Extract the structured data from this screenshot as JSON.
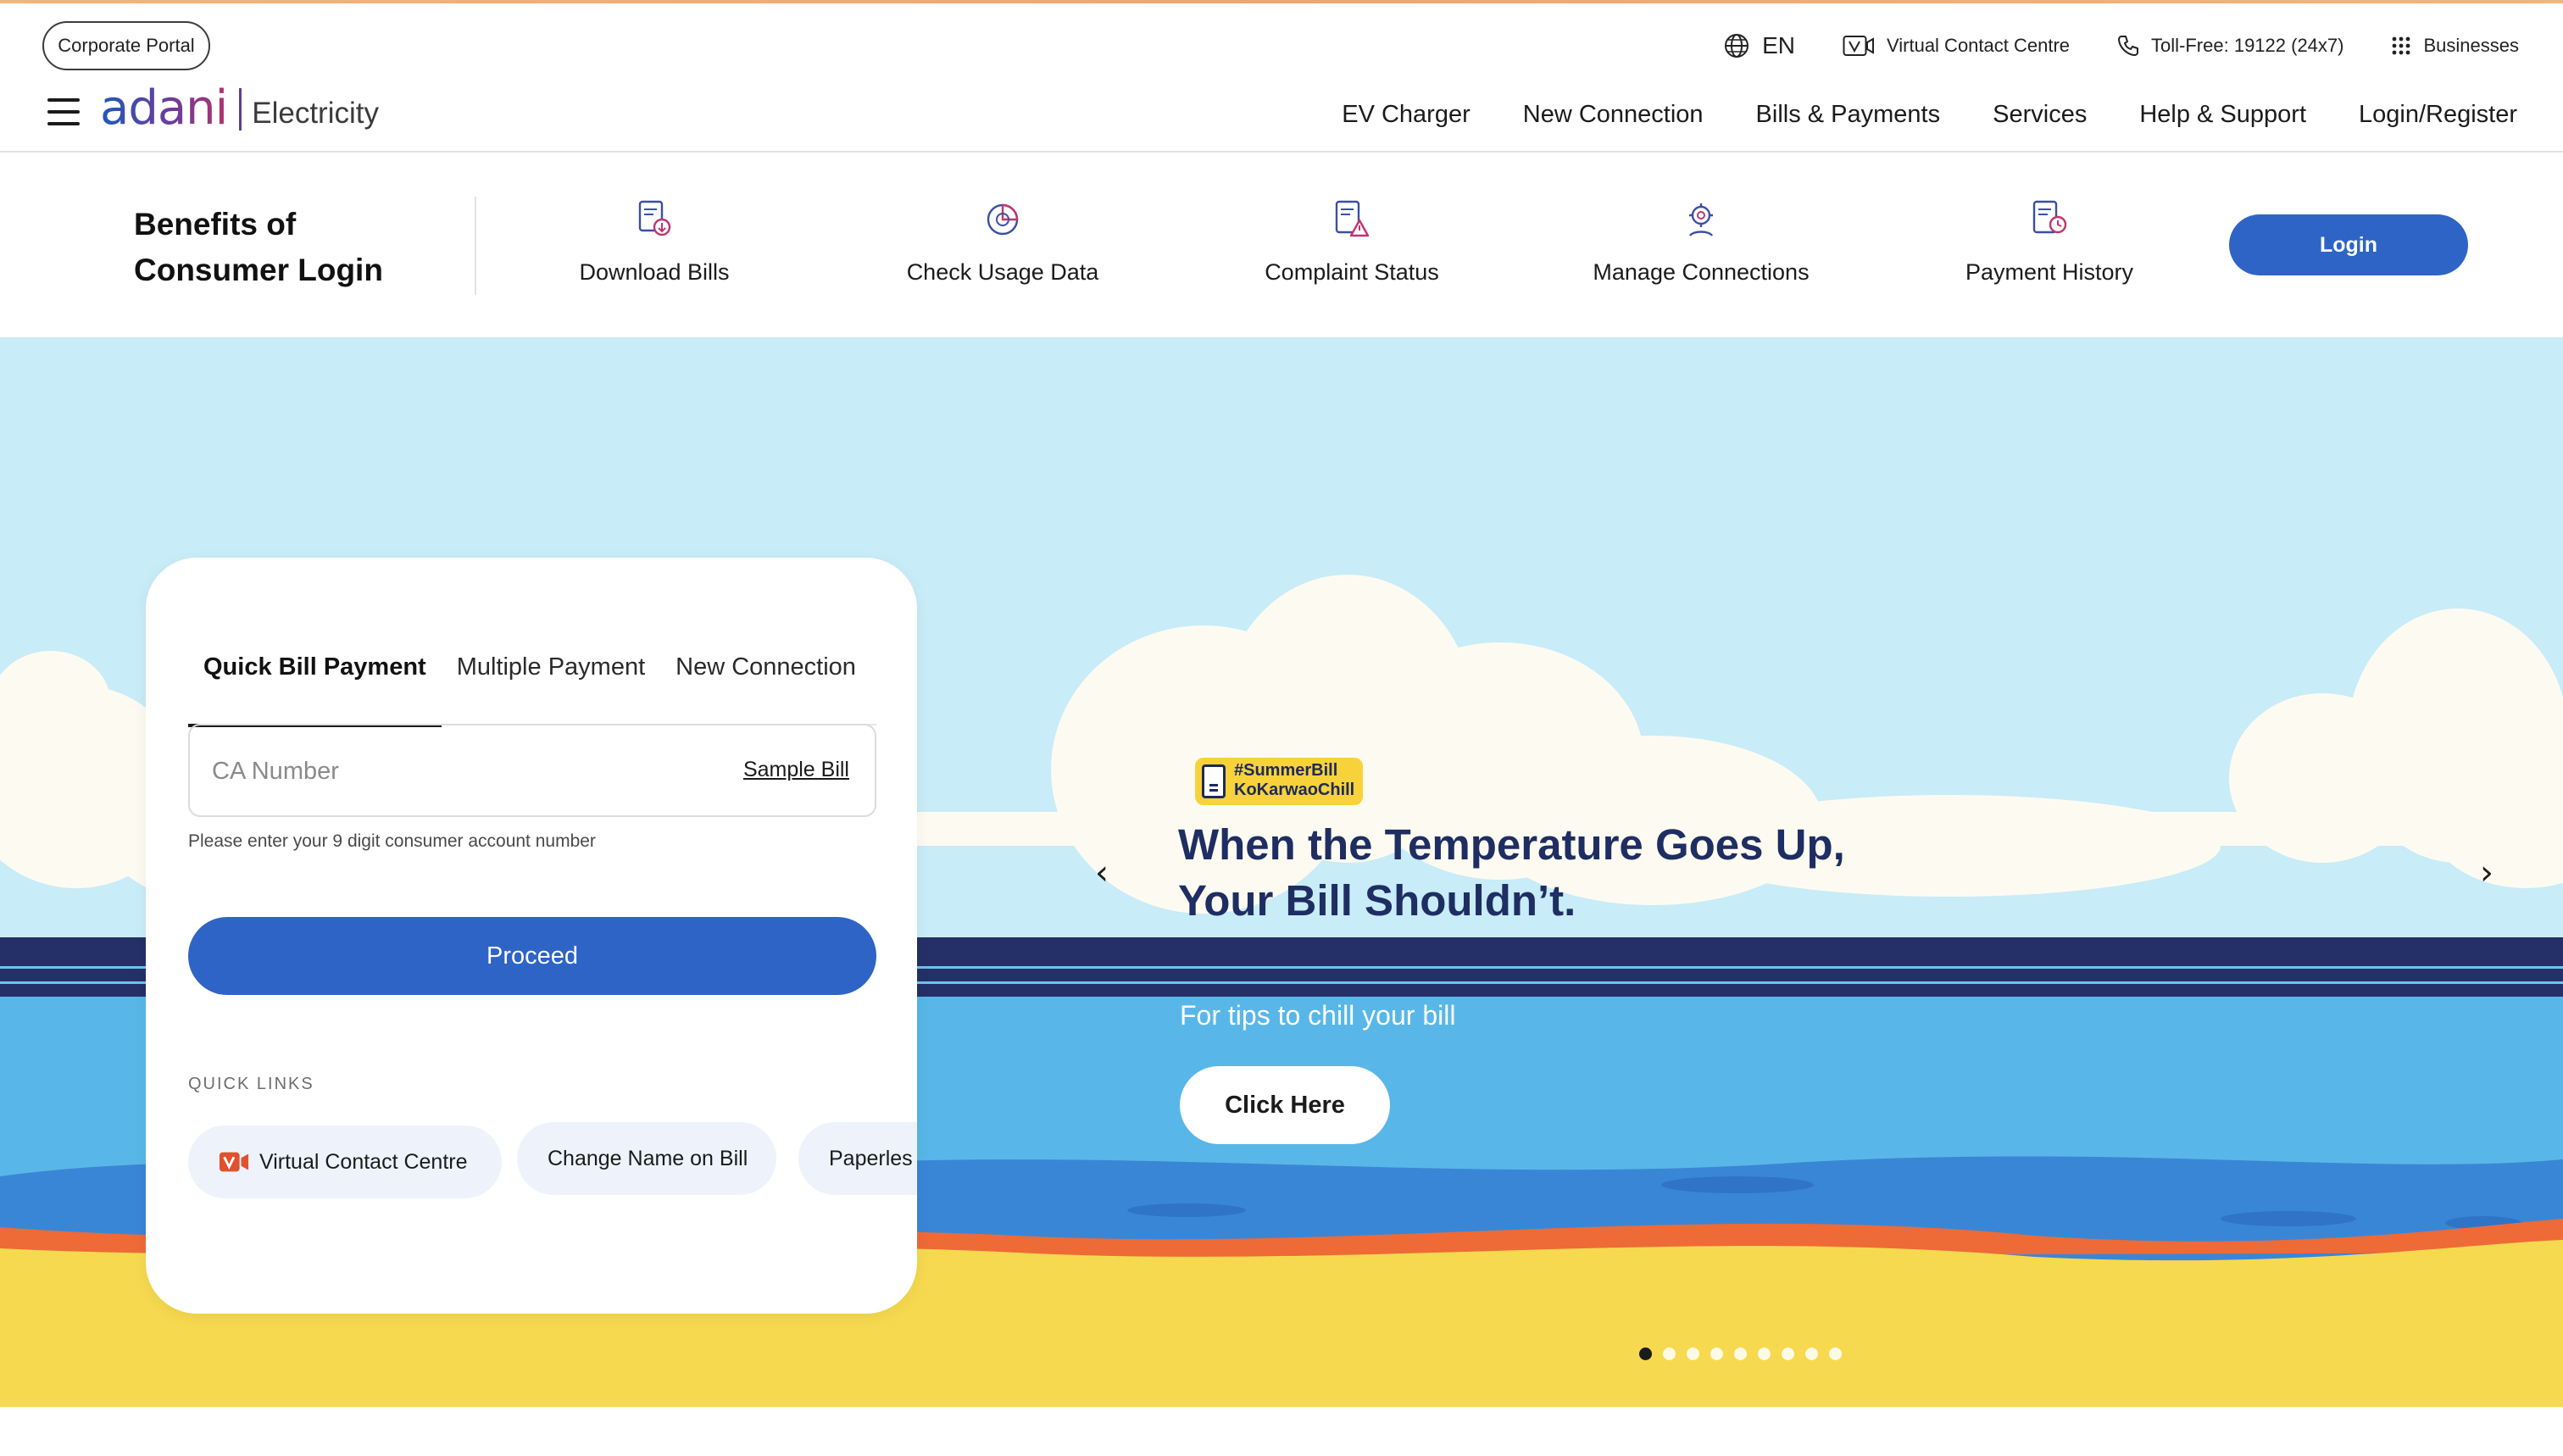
{
  "top_bar": {
    "corporate_portal": "Corporate Portal",
    "language": "EN",
    "virtual_contact": "Virtual Contact Centre",
    "toll_free": "Toll-Free: 19122 (24x7)",
    "businesses": "Businesses"
  },
  "header": {
    "logo_word": "adani",
    "logo_sub": "Electricity",
    "nav": [
      "EV Charger",
      "New Connection",
      "Bills & Payments",
      "Services",
      "Help & Support",
      "Login/Register"
    ]
  },
  "benefits": {
    "title": "Benefits of Consumer Login",
    "items": [
      {
        "label": "Download Bills",
        "icon": "download-bill-icon"
      },
      {
        "label": "Check Usage Data",
        "icon": "usage-chart-icon"
      },
      {
        "label": "Complaint Status",
        "icon": "complaint-icon"
      },
      {
        "label": "Manage Connections",
        "icon": "manage-connections-icon"
      },
      {
        "label": "Payment History",
        "icon": "payment-history-icon"
      }
    ],
    "login_label": "Login"
  },
  "payment_card": {
    "tabs": [
      "Quick Bill Payment",
      "Multiple Payment",
      "New Connection"
    ],
    "active_tab": 0,
    "ca_placeholder": "CA Number",
    "sample_bill": "Sample Bill",
    "hint": "Please enter your 9 digit consumer account number",
    "proceed_label": "Proceed",
    "quick_links_label": "QUICK LINKS",
    "quick_links": [
      "Virtual Contact Centre",
      "Change Name on Bill",
      "Paperles"
    ]
  },
  "hero": {
    "tag_line1": "#SummerBill",
    "tag_line2": "KoKarwaoChill",
    "heading_line1": "When the Temperature Goes Up,",
    "heading_line2": "Your Bill Shouldn’t.",
    "subtext": "For tips to chill your bill",
    "cta_label": "Click Here",
    "slide_count": 9,
    "active_slide": 1,
    "prev_glyph": "‹",
    "next_glyph": "›"
  },
  "colors": {
    "brand_blue": "#2e64c5",
    "heading_navy": "#1e2e63",
    "sky": "#c8ecf8",
    "sea": "#58b7e8",
    "sand": "#f7d94f",
    "accent_orange": "#f0a56d"
  }
}
